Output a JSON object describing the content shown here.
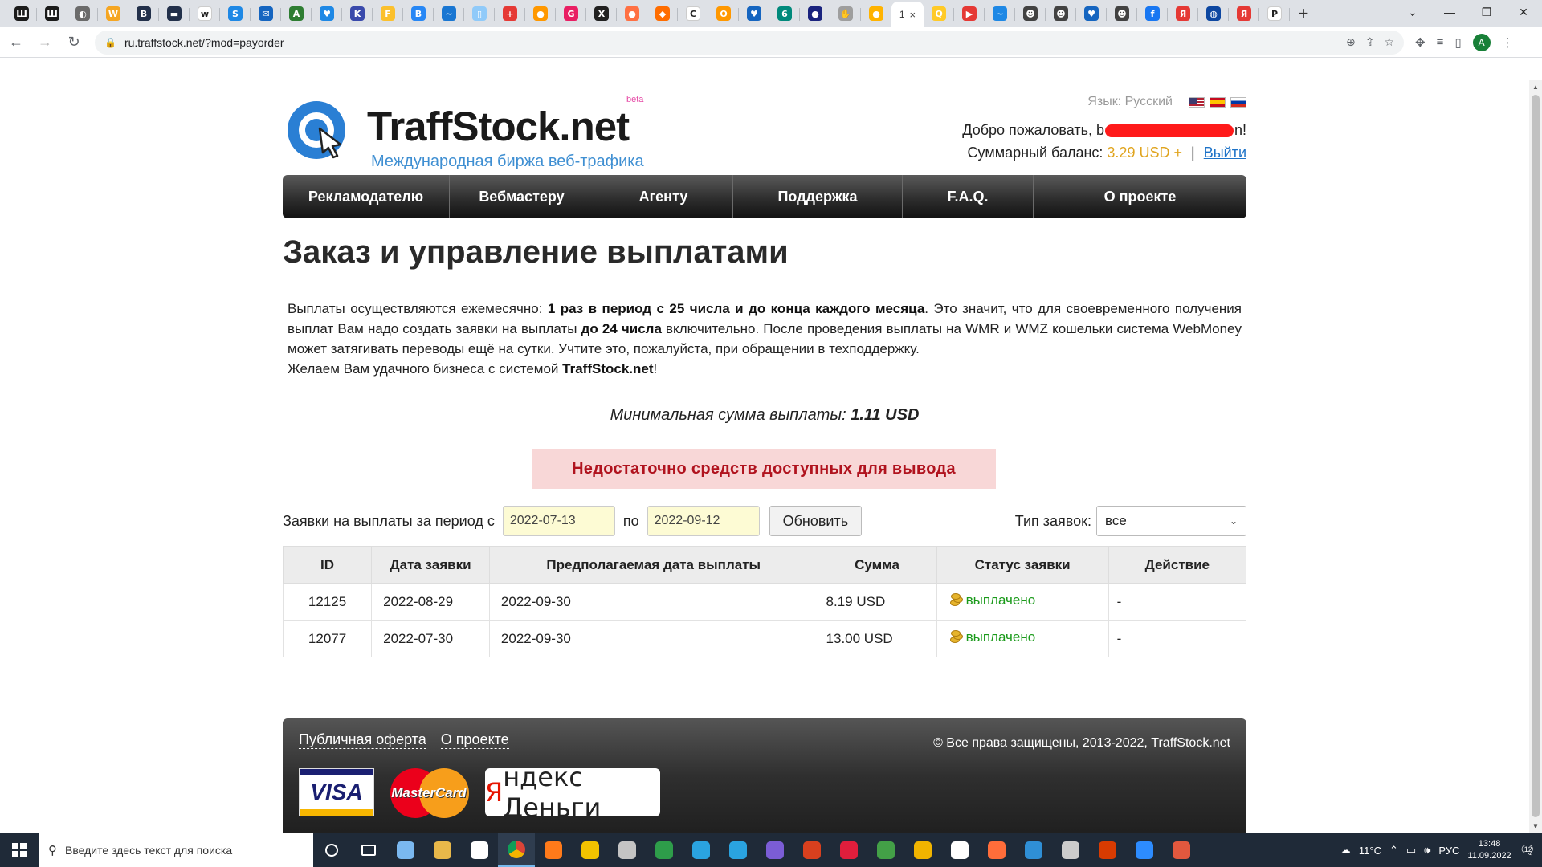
{
  "browser": {
    "active_tab_label": "1",
    "close_glyph": "×",
    "url": "ru.traffstock.net/?mod=payorder",
    "profile_initial": "A",
    "tab_favicons": [
      {
        "c": "#1b1b1b",
        "t": "Ш"
      },
      {
        "c": "#1b1b1b",
        "t": "Ш"
      },
      {
        "c": "#6b6b6b",
        "t": "◐"
      },
      {
        "c": "#f5a623",
        "t": "W"
      },
      {
        "c": "#22304a",
        "t": "B"
      },
      {
        "c": "#22304a",
        "t": "▬"
      },
      {
        "c": "#ffffff",
        "t": "w"
      },
      {
        "c": "#1e88e5",
        "t": "S"
      },
      {
        "c": "#1565c0",
        "t": "✉"
      },
      {
        "c": "#2e7d32",
        "t": "A"
      },
      {
        "c": "#1e88e5",
        "t": "♥"
      },
      {
        "c": "#3949ab",
        "t": "K"
      },
      {
        "c": "#fbc02d",
        "t": "F"
      },
      {
        "c": "#2787f5",
        "t": "B"
      },
      {
        "c": "#1976d2",
        "t": "~"
      },
      {
        "c": "#90caf9",
        "t": "▯"
      },
      {
        "c": "#e53935",
        "t": "+"
      },
      {
        "c": "#ff9800",
        "t": "●"
      },
      {
        "c": "#e91e63",
        "t": "G"
      },
      {
        "c": "#212121",
        "t": "X"
      },
      {
        "c": "#ff7043",
        "t": "●"
      },
      {
        "c": "#ff6d00",
        "t": "◆"
      },
      {
        "c": "#ffffff",
        "t": "C"
      },
      {
        "c": "#ff9800",
        "t": "О"
      },
      {
        "c": "#1565c0",
        "t": "♥"
      },
      {
        "c": "#00897b",
        "t": "6"
      },
      {
        "c": "#1a237e",
        "t": "●"
      },
      {
        "c": "#9e9e9e",
        "t": "✋"
      },
      {
        "c": "#ffb300",
        "t": "●"
      }
    ],
    "tab_favicons_after": [
      {
        "c": "#ffca28",
        "t": "Q"
      },
      {
        "c": "#e53935",
        "t": "▶"
      },
      {
        "c": "#1e88e5",
        "t": "~"
      },
      {
        "c": "#424242",
        "t": "☻"
      },
      {
        "c": "#424242",
        "t": "☻"
      },
      {
        "c": "#1565c0",
        "t": "♥"
      },
      {
        "c": "#424242",
        "t": "☻"
      },
      {
        "c": "#1877f2",
        "t": "f"
      },
      {
        "c": "#e53935",
        "t": "Я"
      },
      {
        "c": "#0d47a1",
        "t": "◍"
      },
      {
        "c": "#e53935",
        "t": "Я"
      },
      {
        "c": "#ffffff",
        "t": "P"
      }
    ]
  },
  "site": {
    "logo_text": "TraffStock.net",
    "logo_subtitle": "Международная биржа веб-трафика",
    "logo_beta": "beta",
    "language_label": "Язык: Русский",
    "welcome_prefix": "Добро пожаловать, ",
    "welcome_start": "b",
    "welcome_end": "n!",
    "balance_label": "Суммарный баланс: ",
    "balance_value": "3.29 USD +",
    "separator": "|",
    "logout": "Выйти"
  },
  "menu": [
    {
      "label": "Рекламодателю",
      "w": 208
    },
    {
      "label": "Вебмастеру",
      "w": 180
    },
    {
      "label": "Агенту",
      "w": 173
    },
    {
      "label": "Поддержка",
      "w": 211
    },
    {
      "label": "F.A.Q.",
      "w": 163
    },
    {
      "label": "О проекте",
      "w": 265
    }
  ],
  "page": {
    "title": "Заказ и управление выплатами",
    "intro_1": "Выплаты осуществляются ежемесячно: ",
    "intro_bold_1": "1 раз в период с 25 числа и до конца каждого месяца",
    "intro_2": ". Это значит, что для своевременного получения выплат Вам надо создать заявки на выплаты ",
    "intro_bold_2": "до 24 числа",
    "intro_3": " включительно. После проведения выплаты на WMR и WMZ кошельки система WebMoney может затягивать переводы ещё на сутки. Учтите это, пожалуйста, при обращении в техподдержку.",
    "intro_4": "Желаем Вам удачного бизнеса с системой ",
    "intro_bold_3": "TraffStock.net",
    "intro_5": "!",
    "min_label": "Минимальная сумма выплаты: ",
    "min_value": "1.11 USD",
    "alert": "Недостаточно средств доступных для вывода"
  },
  "filter": {
    "label": "Заявки на выплаты за период с",
    "from": "2022-07-13",
    "to_label": "по",
    "to": "2022-09-12",
    "refresh": "Обновить",
    "type_label": "Тип заявок:",
    "type_value": "все"
  },
  "table": {
    "headers": [
      "ID",
      "Дата заявки",
      "Предполагаемая дата выплаты",
      "Сумма",
      "Статус заявки",
      "Действие"
    ],
    "rows": [
      {
        "id": "12125",
        "date": "2022-08-29",
        "pay_date": "2022-09-30",
        "sum": "8.19 USD",
        "status": "выплачено",
        "action": "-"
      },
      {
        "id": "12077",
        "date": "2022-07-30",
        "pay_date": "2022-09-30",
        "sum": "13.00 USD",
        "status": "выплачено",
        "action": "-"
      }
    ]
  },
  "footer": {
    "link_offer": "Публичная оферта",
    "link_about": "О проекте",
    "copyright": "© Все права защищены, 2013-2022, TraffStock.net",
    "visa": "VISA",
    "mastercard": "MasterCard",
    "yandex_1": "Я",
    "yandex_2": "ндекс Деньги"
  },
  "taskbar": {
    "search_placeholder": "Введите здесь текст для поиска",
    "temperature": "11°C",
    "lang": "РУС",
    "time": "13:48",
    "date": "11.09.2022",
    "notif_count": "12",
    "apps": [
      "#7ab8f0",
      "#e8b84a",
      "#ffffff",
      "#ffffff",
      "#ff7a1a",
      "#f2c200",
      "#c4c4c4",
      "#2e9d4a",
      "#2aa3e0",
      "#2aa3e0",
      "#7b5dd6",
      "#d9401e",
      "#e01e3c",
      "#43a047",
      "#f1b400",
      "#ffffff",
      "#ff6d3a",
      "#2f8fd6",
      "#cccccc",
      "#d83b01",
      "#2d8cff",
      "#e2583e"
    ]
  }
}
